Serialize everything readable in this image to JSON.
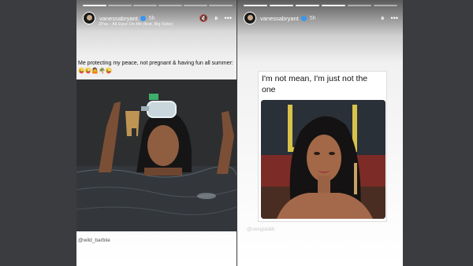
{
  "stories": [
    {
      "username": "vanessabryant",
      "time": "5h",
      "music": "2Pac - All Eyez On Me (feat. Big Syke)",
      "caption": "Me protecting my peace, not pregnant & having fun all summer: 😜😜🤷🌴😜",
      "tag": "@wild_barbiie",
      "controls": {
        "mute": "🔇",
        "pause": "⏸",
        "more": "•••"
      }
    },
    {
      "username": "vanessabryant",
      "time": "5h",
      "meme_text": "I'm not mean, I'm just not the one",
      "tag": "@sexyjolalb",
      "controls": {
        "pause": "⏸",
        "more": "•••"
      }
    }
  ]
}
